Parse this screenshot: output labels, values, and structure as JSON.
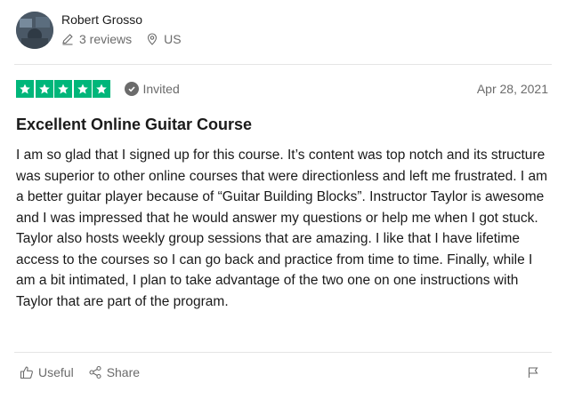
{
  "reviewer": {
    "name": "Robert Grosso",
    "reviews_count": "3 reviews",
    "country": "US"
  },
  "review": {
    "rating": 5,
    "rating_max": 5,
    "status": "Invited",
    "date": "Apr 28, 2021",
    "title": "Excellent Online Guitar Course",
    "body": "I am so glad that I signed up for this course. It’s content was top notch and its structure was superior to other online courses that were directionless and left me frustrated. I am a better guitar player because of “Guitar Building Blocks”. Instructor Taylor is awesome and I was impressed that he would answer my questions or help me when I got stuck. Taylor also hosts weekly group sessions that are amazing. I like that I have lifetime access to the courses so I can go back and practice from time to time. Finally, while I am a bit intimated, I plan to take advantage of the two one on one instructions with Taylor that are part of the program."
  },
  "actions": {
    "useful_label": "Useful",
    "share_label": "Share"
  },
  "icons": {
    "reviews": "pencil-icon",
    "location": "location-pin-icon",
    "star": "star-icon",
    "invited": "check-circle-icon",
    "useful": "thumbs-up-icon",
    "share": "share-icon",
    "report": "flag-icon"
  },
  "colors": {
    "star_fill": "#00b67a",
    "muted_text": "#6b6b6b",
    "text": "#1a1a1a"
  }
}
